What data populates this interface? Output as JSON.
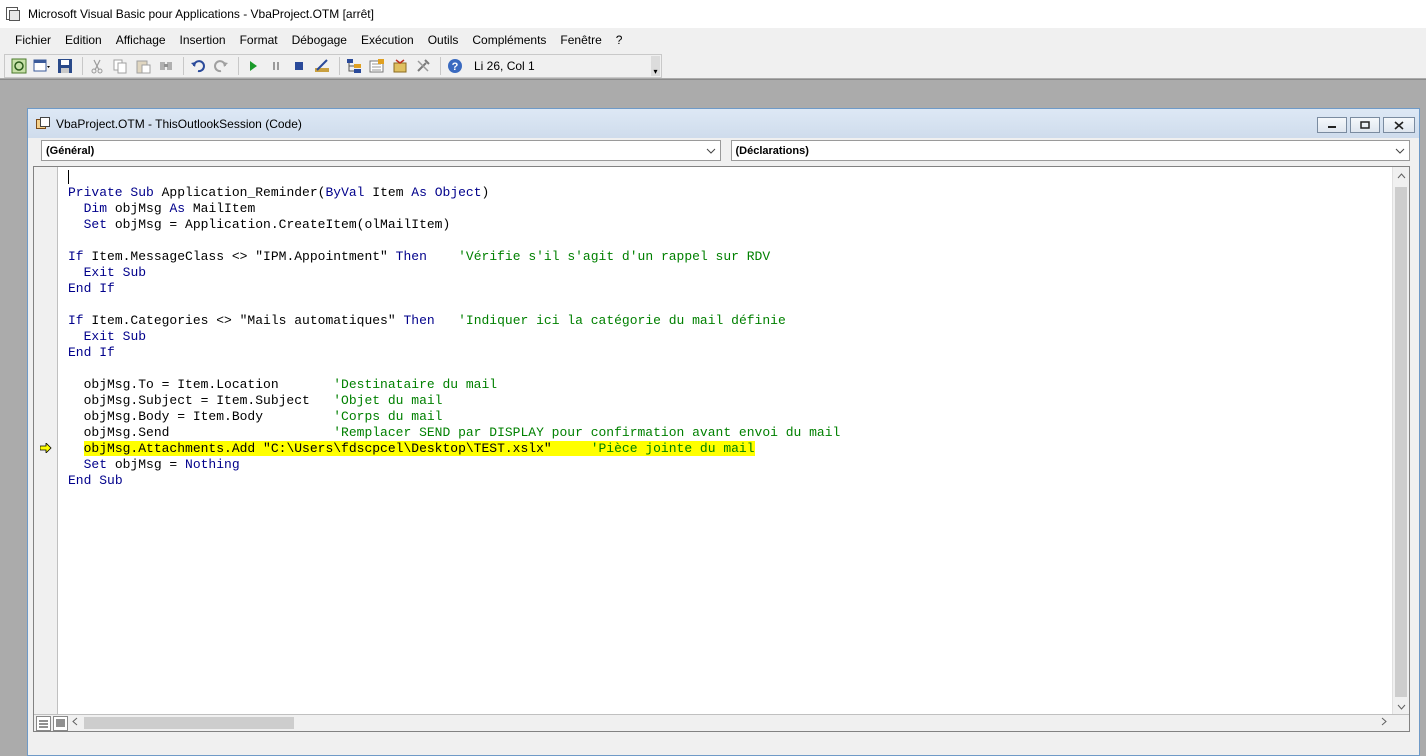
{
  "app": {
    "title": "Microsoft Visual Basic pour Applications - VbaProject.OTM [arrêt]"
  },
  "menu": [
    "Fichier",
    "Edition",
    "Affichage",
    "Insertion",
    "Format",
    "Débogage",
    "Exécution",
    "Outils",
    "Compléments",
    "Fenêtre",
    "?"
  ],
  "toolbar": {
    "buttons": [
      "view-host-app-icon",
      "insert-userform-icon",
      "save-icon",
      "cut-icon",
      "copy-icon",
      "paste-icon",
      "find-icon",
      "undo-icon",
      "redo-icon",
      "run-icon",
      "break-icon",
      "reset-icon",
      "design-mode-icon",
      "project-explorer-icon",
      "properties-icon",
      "object-browser-icon",
      "toolbox-icon",
      "help-icon"
    ],
    "position_text": "Li 26, Col 1"
  },
  "code_window": {
    "title": "VbaProject.OTM - ThisOutlookSession (Code)",
    "object_combo": "(Général)",
    "procedure_combo": "(Déclarations)"
  },
  "code": {
    "l1": "Private Sub Application_Reminder(ByVal Item As Object)",
    "l2": "  Dim objMsg As MailItem",
    "l3": "  Set objMsg = Application.CreateItem(olMailItem)",
    "l5": "If Item.MessageClass <> \"IPM.Appointment\" Then    'Vérifie s'il s'agit d'un rappel sur RDV",
    "l6": "  Exit Sub",
    "l7": "End If",
    "l9": "If Item.Categories <> \"Mails automatiques\" Then   'Indiquer ici la catégorie du mail définie",
    "l10": "  Exit Sub",
    "l11": "End If",
    "l13": "  objMsg.To = Item.Location       'Destinataire du mail",
    "l14": "  objMsg.Subject = Item.Subject   'Objet du mail",
    "l15": "  objMsg.Body = Item.Body         'Corps du mail",
    "l16": "  objMsg.Send                     'Remplacer SEND par DISPLAY pour confirmation avant envoi du mail",
    "l17": "  objMsg.Attachments.Add \"C:\\Users\\fdscpcel\\Desktop\\TEST.xslx\"     'Pièce jointe du mail",
    "l18": "  Set objMsg = Nothing",
    "l19": "End Sub"
  },
  "colors": {
    "keyword": "#00008b",
    "comment": "#008000",
    "execution_highlight": "#ffff00"
  }
}
